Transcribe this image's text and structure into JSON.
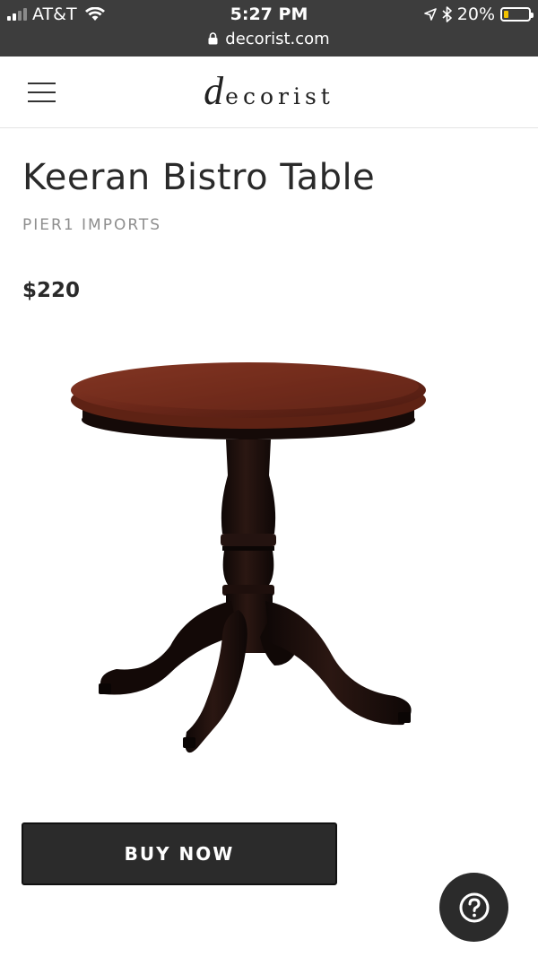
{
  "status_bar": {
    "carrier": "AT&T",
    "time": "5:27 PM",
    "battery_percent": "20%",
    "battery_level": 0.2,
    "signal_bars_filled": 2,
    "signal_bars_total": 4,
    "battery_color": "#f3c200",
    "icons": [
      "signal-icon",
      "wifi-icon",
      "location-arrow-icon",
      "bluetooth-icon",
      "battery-icon",
      "lock-icon"
    ]
  },
  "browser": {
    "url": "decorist.com"
  },
  "header": {
    "logo_first": "d",
    "logo_rest": "ecorist",
    "menu_icon": "hamburger-menu-icon"
  },
  "product": {
    "title": "Keeran Bistro Table",
    "brand": "PIER1 IMPORTS",
    "price": "$220"
  },
  "actions": {
    "buy_label": "BUY NOW",
    "help_icon": "question-mark-icon"
  },
  "colors": {
    "status_bar_bg": "#3d3d3d",
    "button_bg": "#2b2b2b",
    "brand_text": "#8e8e8e",
    "table_top": "#6e2a1c",
    "table_base": "#1a0e0b"
  }
}
